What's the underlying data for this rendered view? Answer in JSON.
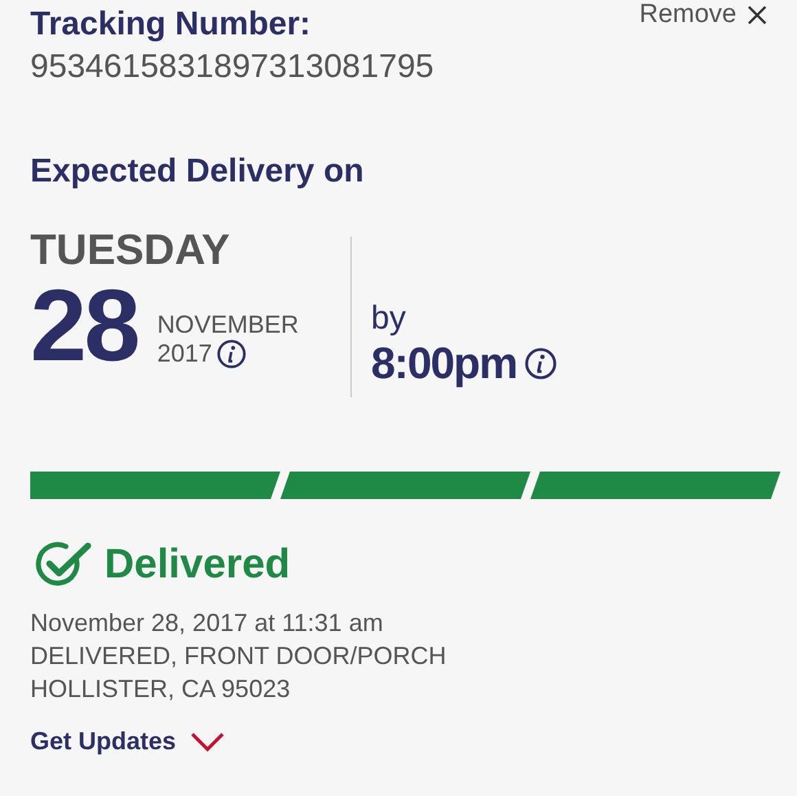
{
  "remove_link": {
    "label": "Remove"
  },
  "tracking": {
    "label": "Tracking Number:",
    "number": "9534615831897313081795"
  },
  "expected": {
    "heading": "Expected Delivery on",
    "weekday": "TUESDAY",
    "day": "28",
    "month": "NOVEMBER",
    "year": "2017",
    "by_label": "by",
    "time": "8:00pm"
  },
  "progress": [
    {
      "filled": true
    },
    {
      "filled": true
    },
    {
      "filled": true
    }
  ],
  "status": {
    "kind": "delivered",
    "label": "Delivered",
    "lines": [
      "November 28, 2017 at 11:31 am",
      "DELIVERED, FRONT DOOR/PORCH",
      "HOLLISTER, CA 95023"
    ]
  },
  "updates": {
    "label": "Get Updates",
    "expanded": false
  }
}
